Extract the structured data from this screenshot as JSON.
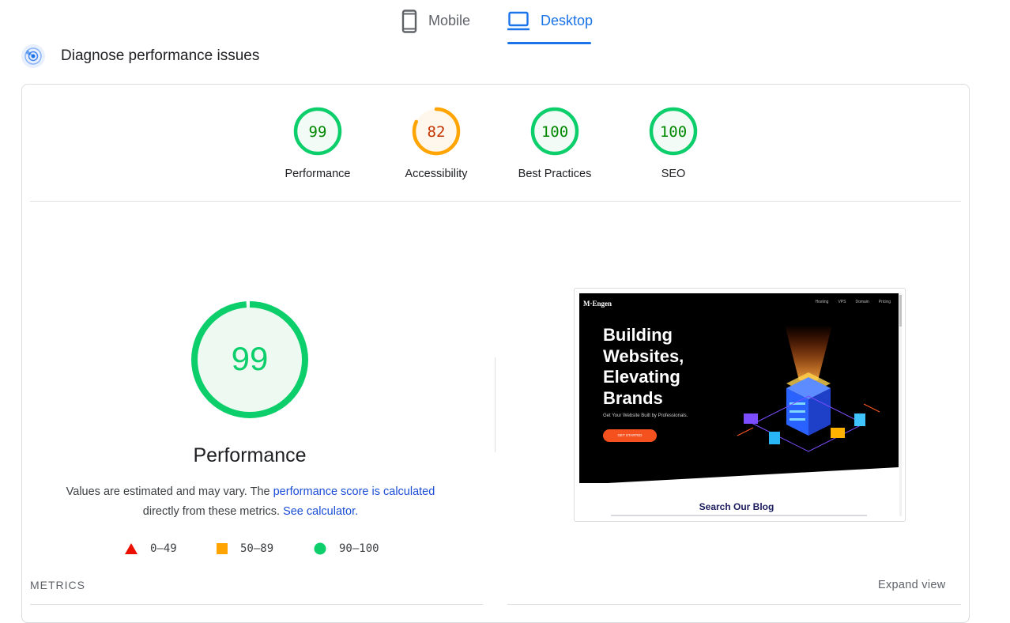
{
  "tabs": [
    {
      "label": "Mobile",
      "icon": "smartphone-icon",
      "active": false
    },
    {
      "label": "Desktop",
      "icon": "laptop-icon",
      "active": true
    }
  ],
  "diagnose": {
    "title": "Diagnose performance issues",
    "icon": "radar-icon"
  },
  "categories": [
    {
      "label": "Performance",
      "score": "99",
      "score_value": 99,
      "status": "pass",
      "color": "#0cce6b"
    },
    {
      "label": "Accessibility",
      "score": "82",
      "score_value": 82,
      "status": "average",
      "color": "#ffa400"
    },
    {
      "label": "Best Practices",
      "score": "100",
      "score_value": 100,
      "status": "pass",
      "color": "#0cce6b"
    },
    {
      "label": "SEO",
      "score": "100",
      "score_value": 100,
      "status": "pass",
      "color": "#0cce6b"
    }
  ],
  "performance": {
    "score": "99",
    "score_value": 99,
    "title": "Performance",
    "desc_prefix": "Values are estimated and may vary. The ",
    "link_score": "performance score is calculated",
    "desc_mid": " directly from these metrics. ",
    "link_calc": "See calculator."
  },
  "legend": [
    {
      "range": "0–49",
      "shape": "triangle",
      "color": "#ff4e42"
    },
    {
      "range": "50–89",
      "shape": "square",
      "color": "#ffa400"
    },
    {
      "range": "90–100",
      "shape": "circle",
      "color": "#0cce6b"
    }
  ],
  "screenshot": {
    "logo": "M·Engen",
    "nav": [
      "Hosting",
      "VPS",
      "Domain",
      "Pricing"
    ],
    "hero_lines": [
      "Building",
      "Websites,",
      "Elevating",
      "Brands"
    ],
    "subtitle": "Get Your Website Built by Professionals.",
    "button": "GET STARTED",
    "blog_title": "Search Our Blog"
  },
  "metrics_label": "METRICS",
  "expand_label": "Expand view",
  "colors": {
    "accent": "#1a73e8",
    "pass": "#0cce6b",
    "average": "#ffa400",
    "fail": "#ff4e42"
  }
}
